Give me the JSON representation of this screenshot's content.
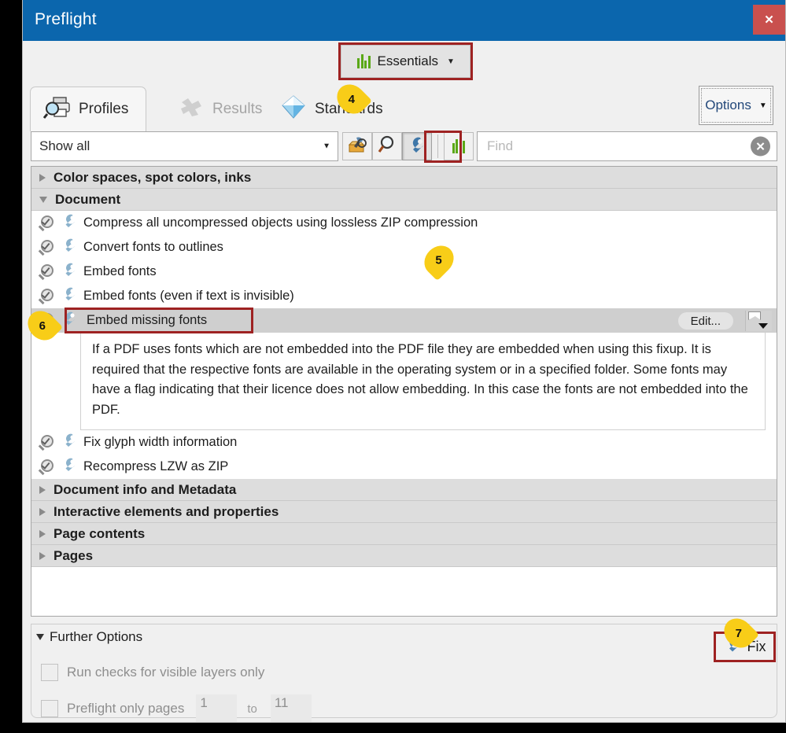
{
  "window": {
    "title": "Preflight",
    "close_label": "✕"
  },
  "profile": {
    "name": "Essentials",
    "caret": "▼",
    "icon": "bar-chart-icon"
  },
  "callouts": [
    {
      "number": "4"
    },
    {
      "number": "5"
    },
    {
      "number": "6"
    },
    {
      "number": "7"
    }
  ],
  "tabs": [
    {
      "label": "Profiles",
      "icon": "profiles-printer-magnifier-icon",
      "active": true
    },
    {
      "label": "Results",
      "icon": "results-puzzle-icon",
      "active": false
    },
    {
      "label": "Standards",
      "icon": "standards-diamond-icon",
      "active": false
    }
  ],
  "options_button": {
    "label": "Options",
    "caret": "▼"
  },
  "filterbar": {
    "show_all": "Show all",
    "dropdown_caret": "▼",
    "tools": [
      {
        "name": "toolbox-icon"
      },
      {
        "name": "magnifier-icon"
      },
      {
        "name": "wrench-icon"
      },
      {
        "name": "bar-chart-icon"
      }
    ],
    "find_placeholder": "Find",
    "find_value": "",
    "clear_label": "✕"
  },
  "list": {
    "groups": [
      {
        "label": "Color spaces, spot colors, inks",
        "expanded": false,
        "items": []
      },
      {
        "label": "Document",
        "expanded": true,
        "items": [
          {
            "label": "Compress all uncompressed objects using lossless ZIP compression",
            "selected": false
          },
          {
            "label": "Convert fonts to outlines",
            "selected": false
          },
          {
            "label": "Embed fonts",
            "selected": false
          },
          {
            "label": "Embed fonts (even if text is invisible)",
            "selected": false
          },
          {
            "label": "Embed missing fonts",
            "selected": true
          },
          {
            "label": "Fix glyph width information",
            "selected": false
          },
          {
            "label": "Recompress LZW as ZIP",
            "selected": false
          }
        ]
      },
      {
        "label": "Document info and Metadata",
        "expanded": false,
        "items": []
      },
      {
        "label": "Interactive elements and properties",
        "expanded": false,
        "items": []
      },
      {
        "label": "Page contents",
        "expanded": false,
        "items": []
      },
      {
        "label": "Pages",
        "expanded": false,
        "items": []
      }
    ],
    "selected_detail": {
      "edit_label": "Edit...",
      "description": "If a PDF uses fonts which are not embedded into the PDF file they are embedded when using this fixup. It is required that the respective fonts are available in the operating system or in a specified folder. Some fonts may have a flag indicating that their licence does not allow embedding. In this case the fonts are not embedded into the PDF."
    }
  },
  "further_options": {
    "label": "Further Options",
    "triangle": "▼",
    "fix_label": "Fix",
    "checkbox_visible_layers": "Run checks for visible layers only",
    "checkbox_preflight_pages": "Preflight only pages",
    "page_from": "1",
    "page_to_label": "to",
    "page_to": "11"
  },
  "colors": {
    "titlebar": "#0b66ad",
    "close": "#c9504e",
    "annotation_red": "#9e2222",
    "callout_yellow": "#f8cd18",
    "selection_gray": "#cfcfcf",
    "group_header": "#dddddd",
    "wrench_blue": "#5b86ad",
    "bars_green": "#5aa817"
  }
}
